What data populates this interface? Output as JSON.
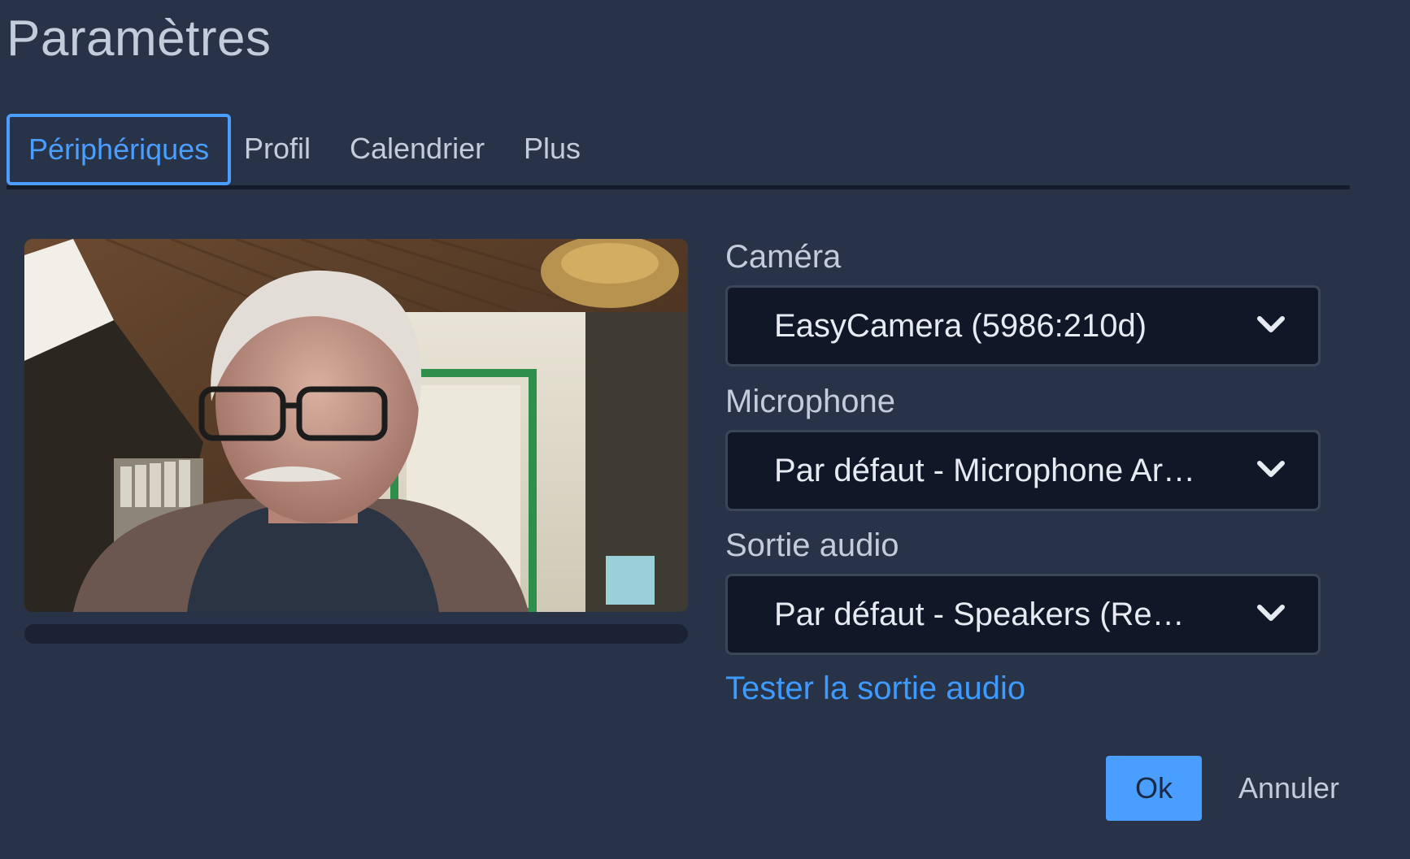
{
  "page_title": "Paramètres",
  "tabs": [
    {
      "label": "Périphériques",
      "active": true
    },
    {
      "label": "Profil",
      "active": false
    },
    {
      "label": "Calendrier",
      "active": false
    },
    {
      "label": "Plus",
      "active": false
    }
  ],
  "devices": {
    "camera": {
      "label": "Caméra",
      "value": "EasyCamera (5986:210d)",
      "icon": "chevron-down-icon"
    },
    "microphone": {
      "label": "Microphone",
      "value": "Par défaut - Microphone Ar…",
      "icon": "chevron-down-icon"
    },
    "audio_output": {
      "label": "Sortie audio",
      "value": "Par défaut - Speakers (Re…",
      "icon": "chevron-down-icon"
    },
    "test_audio_link": "Tester la sortie audio"
  },
  "buttons": {
    "ok": "Ok",
    "cancel": "Annuler"
  },
  "colors": {
    "background": "#283347",
    "accent": "#4a9eff",
    "link": "#3d9bff",
    "select_bg": "#101726",
    "text": "#c3ccda"
  }
}
